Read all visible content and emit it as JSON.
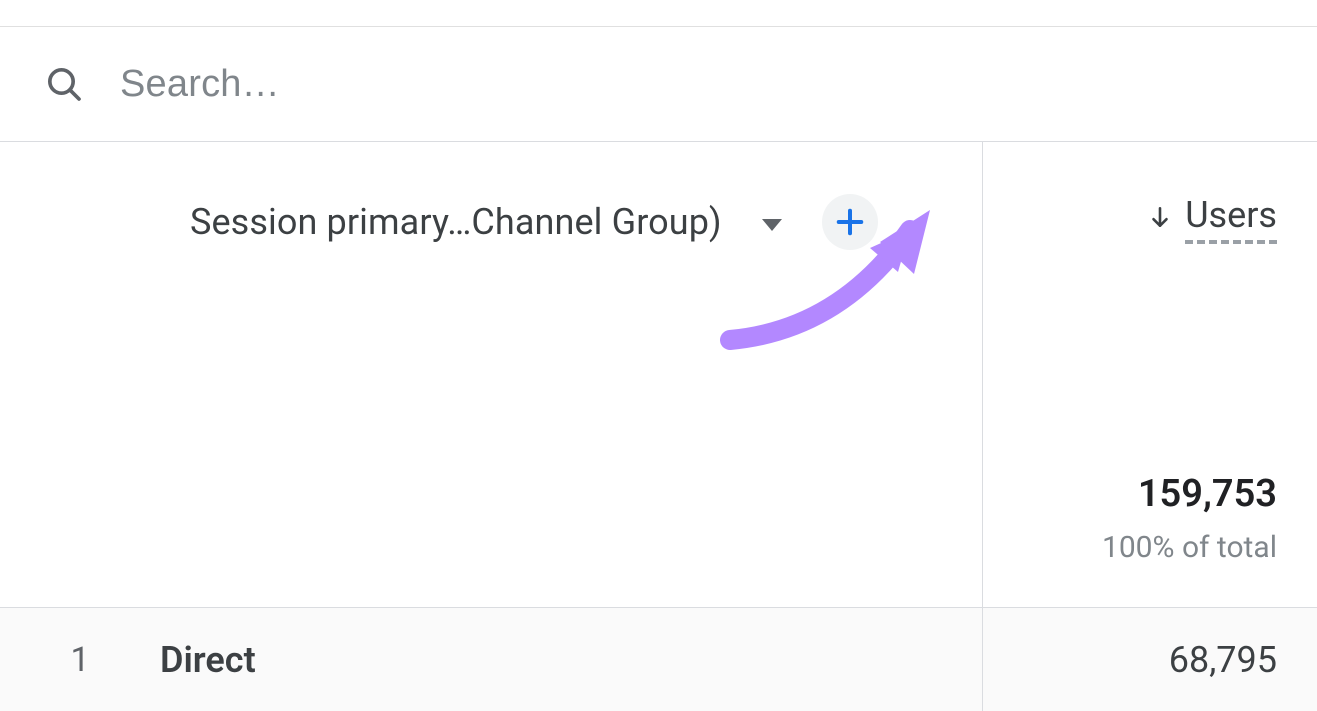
{
  "search": {
    "placeholder": "Search…",
    "value": ""
  },
  "dimension": {
    "label": "Session primary…Channel Group)",
    "add_icon": "plus-icon",
    "dropdown_icon": "chevron-down-icon"
  },
  "metric": {
    "name": "Users",
    "sort_direction": "desc",
    "total_value": "159,753",
    "total_subtext": "100% of total"
  },
  "rows": [
    {
      "index": "1",
      "name": "Direct",
      "value": "68,795"
    }
  ],
  "annotation": {
    "type": "arrow",
    "target": "add-dimension-button",
    "color": "#b388ff"
  }
}
